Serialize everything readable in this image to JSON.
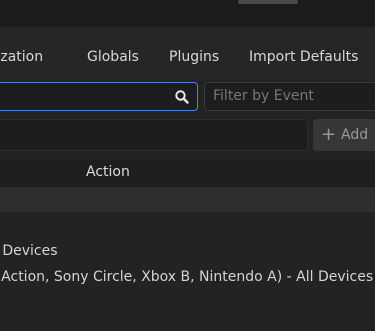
{
  "tabs": [
    {
      "label": "alization"
    },
    {
      "label": "Globals"
    },
    {
      "label": "Plugins"
    },
    {
      "label": "Import Defaults"
    }
  ],
  "search": {
    "icon": "search-icon",
    "value": "",
    "filter_placeholder": "Filter by Event"
  },
  "add_button": {
    "label": "Add",
    "icon": "plus-icon"
  },
  "table": {
    "column_action": "Action"
  },
  "rows": [
    {
      "text": "l Devices"
    },
    {
      "text": ": Action, Sony Circle, Xbox B, Nintendo A) - All Devices"
    }
  ],
  "colors": {
    "accent": "#4f87d6",
    "background": "#232325",
    "header": "#1e1e20"
  }
}
